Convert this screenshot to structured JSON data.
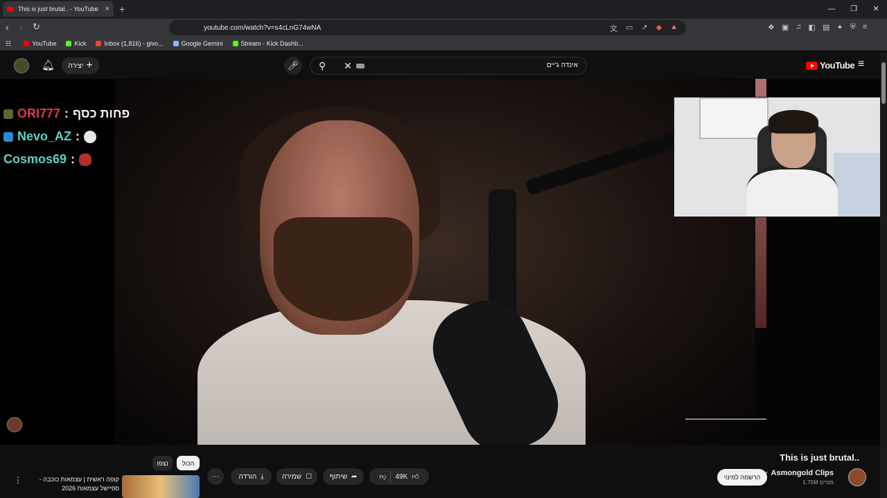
{
  "browser": {
    "tab_title": "This is just brutal.. - YouTube",
    "tab_close": "×",
    "new_tab": "+",
    "url": "youtube.com/watch?v=s4cLnG74wNA",
    "window_controls": [
      "—",
      "❐",
      "✕"
    ],
    "bookmarks": [
      {
        "label": "YouTube",
        "color": "#ff0000"
      },
      {
        "label": "Kick",
        "color": "#53fc18"
      },
      {
        "label": "Inbox (1,816) - givo...",
        "color": "#ea4335"
      },
      {
        "label": "Google Gemini",
        "color": "#8ab4f8"
      },
      {
        "label": "Stream - Kick Dashb...",
        "color": "#53fc18"
      }
    ]
  },
  "youtube_header": {
    "create_label": "יצירה",
    "search_value": "אינדה ג'יים",
    "logo_text": "YouTube"
  },
  "video_overlay": {
    "chat": [
      {
        "user": "ORI777",
        "sep": ":",
        "message": "פחות כסף",
        "color": "#e03a4a",
        "msg_color": "#ffffff",
        "badge_color": "#5a6a2a"
      },
      {
        "user": "Nevo_AZ",
        "sep": ":",
        "message": "",
        "color": "#5fd1c4",
        "msg_color": "#ffffff",
        "badge_color": "#2a8ad0"
      },
      {
        "user": "Cosmos69",
        "sep": ":",
        "message": "",
        "color": "#5fd1c4",
        "msg_color": "#ffffff",
        "badge_color": "#b03030"
      }
    ]
  },
  "video_info": {
    "title": "This is just brutal..",
    "channel_name": "Asmongold Clips",
    "verified_icon": "✔",
    "subscribers": "1.75M מנויים",
    "subscribe_label": "הרשמה למינוי",
    "likes": "49K",
    "share_label": "שיתוף",
    "save_label": "שמירה",
    "download_label": "הורדה",
    "more_label": "⋯"
  },
  "recommendations": {
    "chip_all": "הכול",
    "chip_watched": "נצפו",
    "first_title": "קופה ראשית | עצמאות כוכבה - ספיישל עצמאות 2026"
  }
}
